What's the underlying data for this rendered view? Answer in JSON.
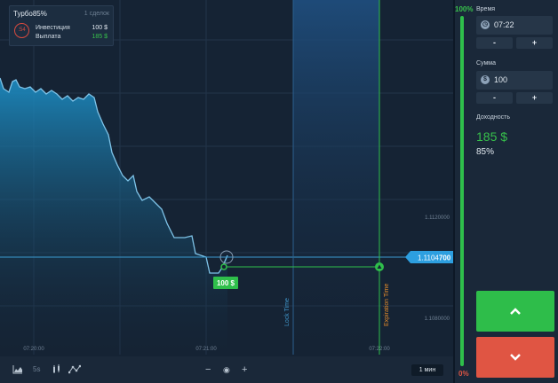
{
  "deal_box": {
    "title": "Турбо85%",
    "count": "1 сделок",
    "timer": ":54",
    "investment_label": "Инвестиция",
    "investment_value": "100 $",
    "payout_label": "Выплата",
    "payout_value": "185 $"
  },
  "chart": {
    "price_levels": [
      "1.1120000",
      "1.1080000"
    ],
    "current_price_prefix": "1.1104",
    "current_price_suffix": "700",
    "time_labels": [
      "07:20:00",
      "07:21:00",
      "07:22:00"
    ],
    "lock_time_label": "Lock Time",
    "expiration_label": "Expiration Time",
    "trade_badge": "100 $",
    "colors": {
      "line": "#58a9d8",
      "trade": "#2fbf4b",
      "expiration": "#e08a2a"
    }
  },
  "toolbar": {
    "interval": "5s",
    "zoom_out": "−",
    "zoom_reset": "◉",
    "zoom_in": "+",
    "period": "1 мин",
    "icons": [
      "area-chart-icon",
      "candles-icon",
      "indicators-icon"
    ]
  },
  "side_panel": {
    "top_percent": "100%",
    "bottom_percent": "0%",
    "sentiment_up_fraction": 1.0,
    "time_label": "Время",
    "time_value": "07:22",
    "minus": "-",
    "plus": "+",
    "amount_label": "Сумма",
    "amount_value": "100",
    "amount_currency_icon": "$",
    "payout_label": "Доходность",
    "payout_value": "185 $",
    "payout_percent": "85%",
    "up_icon": "⌃",
    "down_icon": "⌄"
  }
}
